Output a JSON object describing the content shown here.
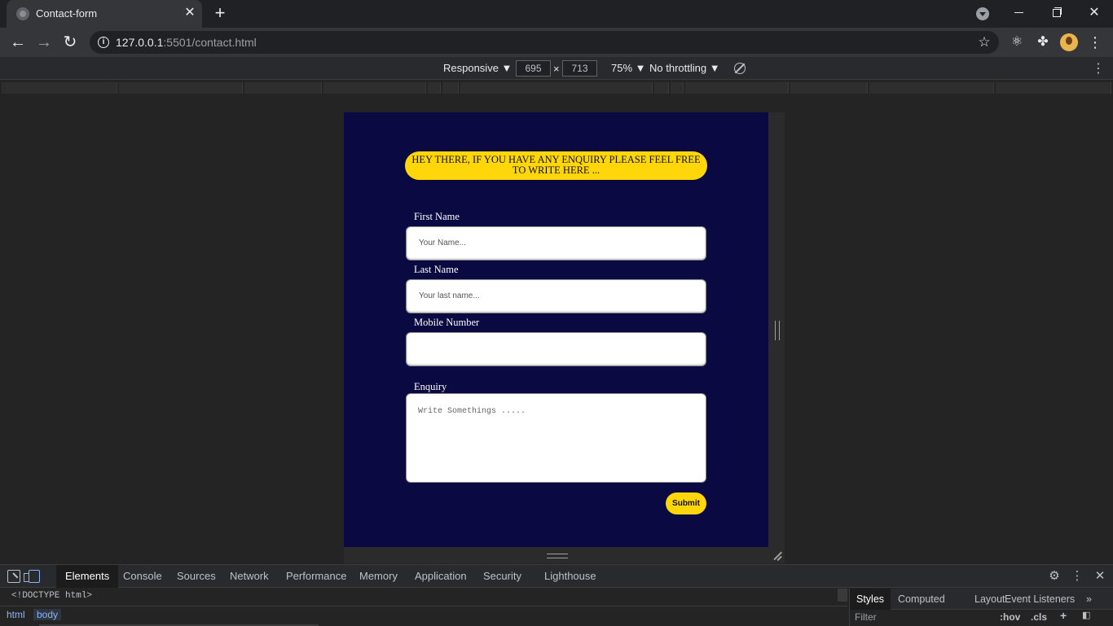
{
  "browser": {
    "tab_title": "Contact-form",
    "url_host": "127.0.0.1",
    "url_rest": ":5501/contact.html"
  },
  "device_toolbar": {
    "mode": "Responsive ▼",
    "width": "695",
    "times": "×",
    "height": "713",
    "zoom": "75% ▼",
    "throttling": "No throttling ▼"
  },
  "page": {
    "banner": "HEY THERE, IF YOU HAVE ANY ENQUIRY PLEASE FEEL FREE TO WRITE HERE ...",
    "fields": [
      {
        "label": "First Name",
        "placeholder": "Your Name..."
      },
      {
        "label": "Last Name",
        "placeholder": "Your last name..."
      },
      {
        "label": "Mobile Number",
        "placeholder": ""
      }
    ],
    "enquiry_label": "Enquiry",
    "enquiry_placeholder": "Write Somethings .....",
    "submit_label": "Submit",
    "colors": {
      "background": "#0b0942",
      "accent": "#ffd60a"
    }
  },
  "devtools": {
    "tabs": [
      "Elements",
      "Console",
      "Sources",
      "Network",
      "Performance",
      "Memory",
      "Application",
      "Security",
      "Lighthouse"
    ],
    "active_tab": "Elements",
    "doctype": "<!DOCTYPE html>",
    "breadcrumbs": [
      "html",
      "body"
    ],
    "styles_tabs": [
      "Styles",
      "Computed",
      "Layout",
      "Event Listeners"
    ],
    "filter_placeholder": "Filter",
    "hov": ":hov",
    "cls": ".cls"
  }
}
